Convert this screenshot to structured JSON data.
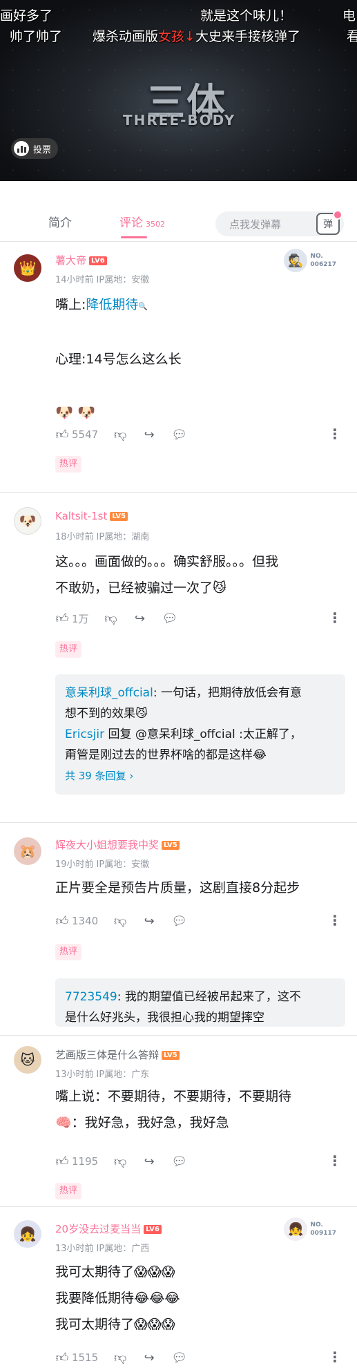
{
  "video": {
    "danmaku": [
      {
        "text": "画好多了",
        "red": ""
      },
      {
        "text": "就是这个味儿！",
        "red": ""
      },
      {
        "text": "电",
        "red": ""
      },
      {
        "text": "帅了帅了",
        "red": ""
      },
      {
        "text": "爆杀动画版",
        "red": "女孩↓",
        "tail": "大史来手接核弹了"
      },
      {
        "text": "看",
        "red": ""
      }
    ],
    "logo_cn": "三体",
    "logo_en": "THREE-BODY",
    "vote_label": "投票"
  },
  "tabs": {
    "intro": "简介",
    "comments": "评论",
    "comment_count": "3502",
    "danmaku_placeholder": "点我发弹幕",
    "danmaku_toggle": "弹"
  },
  "comments": [
    {
      "user": "薯大帝",
      "level": "LV6",
      "time": "14小时前",
      "ip": "IP属地：安徽",
      "badge": "NO.\n006217",
      "lines": [
        "嘴上:降低期待",
        "",
        "心理:14号怎么这么长",
        "",
        "🐶 🐶"
      ],
      "likes": "5547",
      "tag": "热评"
    },
    {
      "user": "Kaltsit-1st",
      "level": "LV5",
      "time": "18小时前",
      "ip": "IP属地：湖南",
      "lines": [
        "这。。。画面做的。。。确实舒服。。。但我",
        "不敢奶，已经被骗过一次了😼"
      ],
      "likes": "1万",
      "tag": "热评",
      "replies": [
        {
          "user": "意呆利球_offcial",
          "text": ": 一句话，把期待放低会有意"
        },
        {
          "user": "",
          "text": "想不到的效果😼"
        },
        {
          "user": "Ericsjir",
          "text": " 回复 @意呆利球_offcial :太正解了，"
        },
        {
          "user": "",
          "text": "甭管是刚过去的世界杯啥的都是这样😂"
        }
      ],
      "reply_more": "共 39 条回复 ›"
    },
    {
      "user": "辉夜大小姐想要我中奖",
      "level": "LV5",
      "time": "19小时前",
      "ip": "IP属地：安徽",
      "lines": [
        "正片要全是预告片质量，这剧直接8分起步"
      ],
      "likes": "1340",
      "tag": "热评",
      "replies": [
        {
          "user": "7723549",
          "text": ": 我的期望值已经被吊起来了，这不"
        },
        {
          "user": "",
          "text": "是什么好兆头，我很担心我的期望摔空"
        }
      ]
    },
    {
      "user": "艺画版三体是什么答辩",
      "level": "LV5",
      "time": "13小时前",
      "ip": "IP属地：广东",
      "lines": [
        "嘴上说：不要期待，不要期待，不要期待",
        "🧠：我好急，我好急，我好急"
      ],
      "likes": "1195",
      "tag": "热评"
    },
    {
      "user": "20岁没去过麦当当",
      "level": "LV6",
      "time": "13小时前",
      "ip": "IP属地：广西",
      "badge": "NO.\n009117",
      "lines": [
        "我可太期待了😱😱😱",
        "我要降低期待😂😂😂",
        "我可太期待了😱😱😱"
      ],
      "likes": "1515"
    }
  ]
}
